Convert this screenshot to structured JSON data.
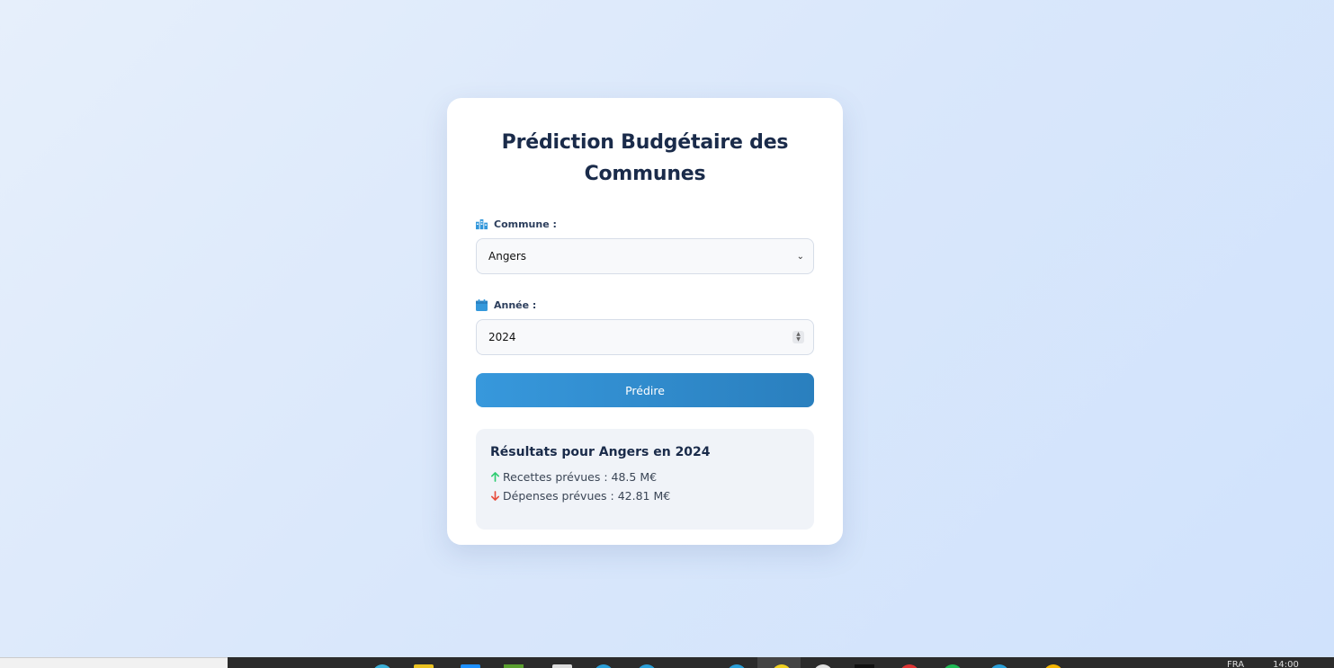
{
  "app": {
    "title": "Prédiction Budgétaire des Communes"
  },
  "form": {
    "commune_label": "Commune :",
    "commune_value": "Angers",
    "annee_label": "Année :",
    "annee_value": "2024",
    "submit_label": "Prédire"
  },
  "results": {
    "title": "Résultats pour Angers en 2024",
    "recettes": "Recettes prévues : 48.5 M€",
    "depenses": "Dépenses prévues : 42.81 M€"
  },
  "colors": {
    "accent": "#3498db",
    "up": "#2ecc71",
    "down": "#e74c3c",
    "title": "#1a2b4a"
  },
  "taskbar": {
    "lang": "FRA",
    "time": "14:00"
  }
}
